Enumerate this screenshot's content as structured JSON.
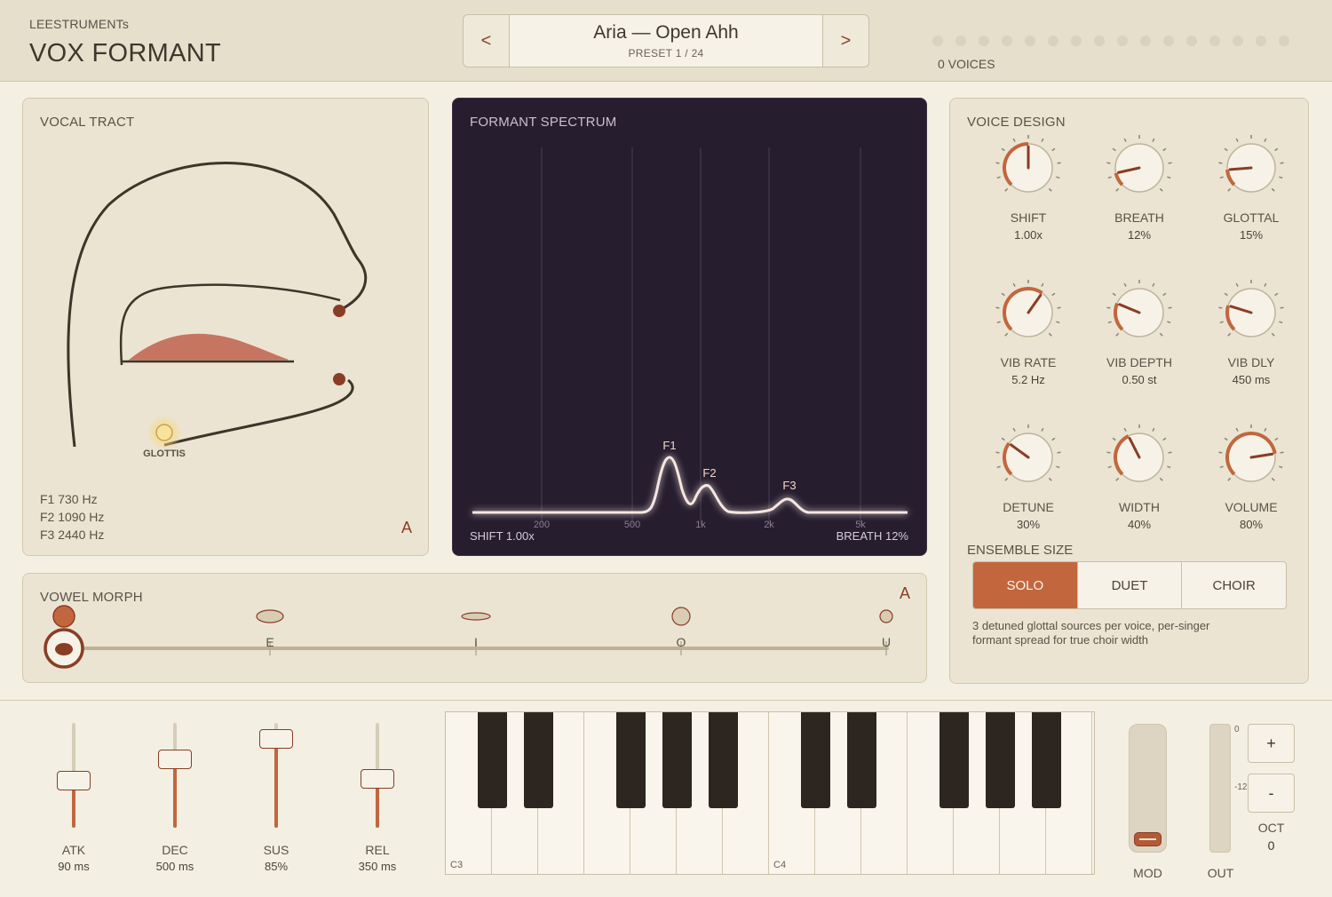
{
  "header": {
    "brand": "LEESTRUMENTs",
    "title": "VOX FORMANT",
    "preset_prev": "<",
    "preset_next": ">",
    "preset_name": "Aria — Open Ahh",
    "preset_number": "PRESET 1 / 24",
    "voices_label": "0 VOICES"
  },
  "vocal_tract": {
    "title": "VOCAL TRACT",
    "glottis_label": "GLOTTIS",
    "formants": [
      "F1 730 Hz",
      "F2 1090 Hz",
      "F3 2440 Hz"
    ],
    "vowel": "A"
  },
  "spectrum": {
    "title": "FORMANT SPECTRUM",
    "freq_ticks": [
      "200",
      "500",
      "1k",
      "2k",
      "5k"
    ],
    "peaks": [
      "F1",
      "F2",
      "F3"
    ],
    "footer_left": "SHIFT 1.00x",
    "footer_right": "BREATH 12%"
  },
  "voice_design": {
    "title": "VOICE DESIGN",
    "knobs": [
      {
        "label": "SHIFT",
        "value": "1.00x",
        "level": 0.5
      },
      {
        "label": "BREATH",
        "value": "12%",
        "level": 0.12
      },
      {
        "label": "GLOTTAL",
        "value": "15%",
        "level": 0.15
      },
      {
        "label": "VIB RATE",
        "value": "5.2 Hz",
        "level": 0.63
      },
      {
        "label": "VIB DEPTH",
        "value": "0.50 st",
        "level": 0.25
      },
      {
        "label": "VIB DLY",
        "value": "450 ms",
        "level": 0.23
      },
      {
        "label": "DETUNE",
        "value": "30%",
        "level": 0.3
      },
      {
        "label": "WIDTH",
        "value": "40%",
        "level": 0.4
      },
      {
        "label": "VOLUME",
        "value": "80%",
        "level": 0.8
      }
    ],
    "ensemble_title": "ENSEMBLE SIZE",
    "ensemble_options": [
      "SOLO",
      "DUET",
      "CHOIR"
    ],
    "ensemble_selected": "SOLO",
    "ensemble_desc": "3 detuned glottal sources per voice, per-singer formant spread for true choir width"
  },
  "vowel_morph": {
    "title": "VOWEL MORPH",
    "current": "A",
    "vowels": [
      "A",
      "E",
      "I",
      "O",
      "U"
    ],
    "position": 0
  },
  "envelope": [
    {
      "label": "ATK",
      "value": "90 ms",
      "level": 0.45
    },
    {
      "label": "DEC",
      "value": "500 ms",
      "level": 0.65
    },
    {
      "label": "SUS",
      "value": "85%",
      "level": 0.85
    },
    {
      "label": "REL",
      "value": "350 ms",
      "level": 0.47
    }
  ],
  "keyboard": {
    "labels": [
      "C3",
      "C4"
    ]
  },
  "mod_label": "MOD",
  "out": {
    "label": "OUT",
    "mark_top": "0",
    "mark_mid": "-12"
  },
  "octave": {
    "plus": "+",
    "minus": "-",
    "label": "OCT",
    "value": "0"
  },
  "colors": {
    "accent": "#c2663e",
    "dark_accent": "#8a3d25",
    "spectrum_bg": "#261d2e"
  }
}
